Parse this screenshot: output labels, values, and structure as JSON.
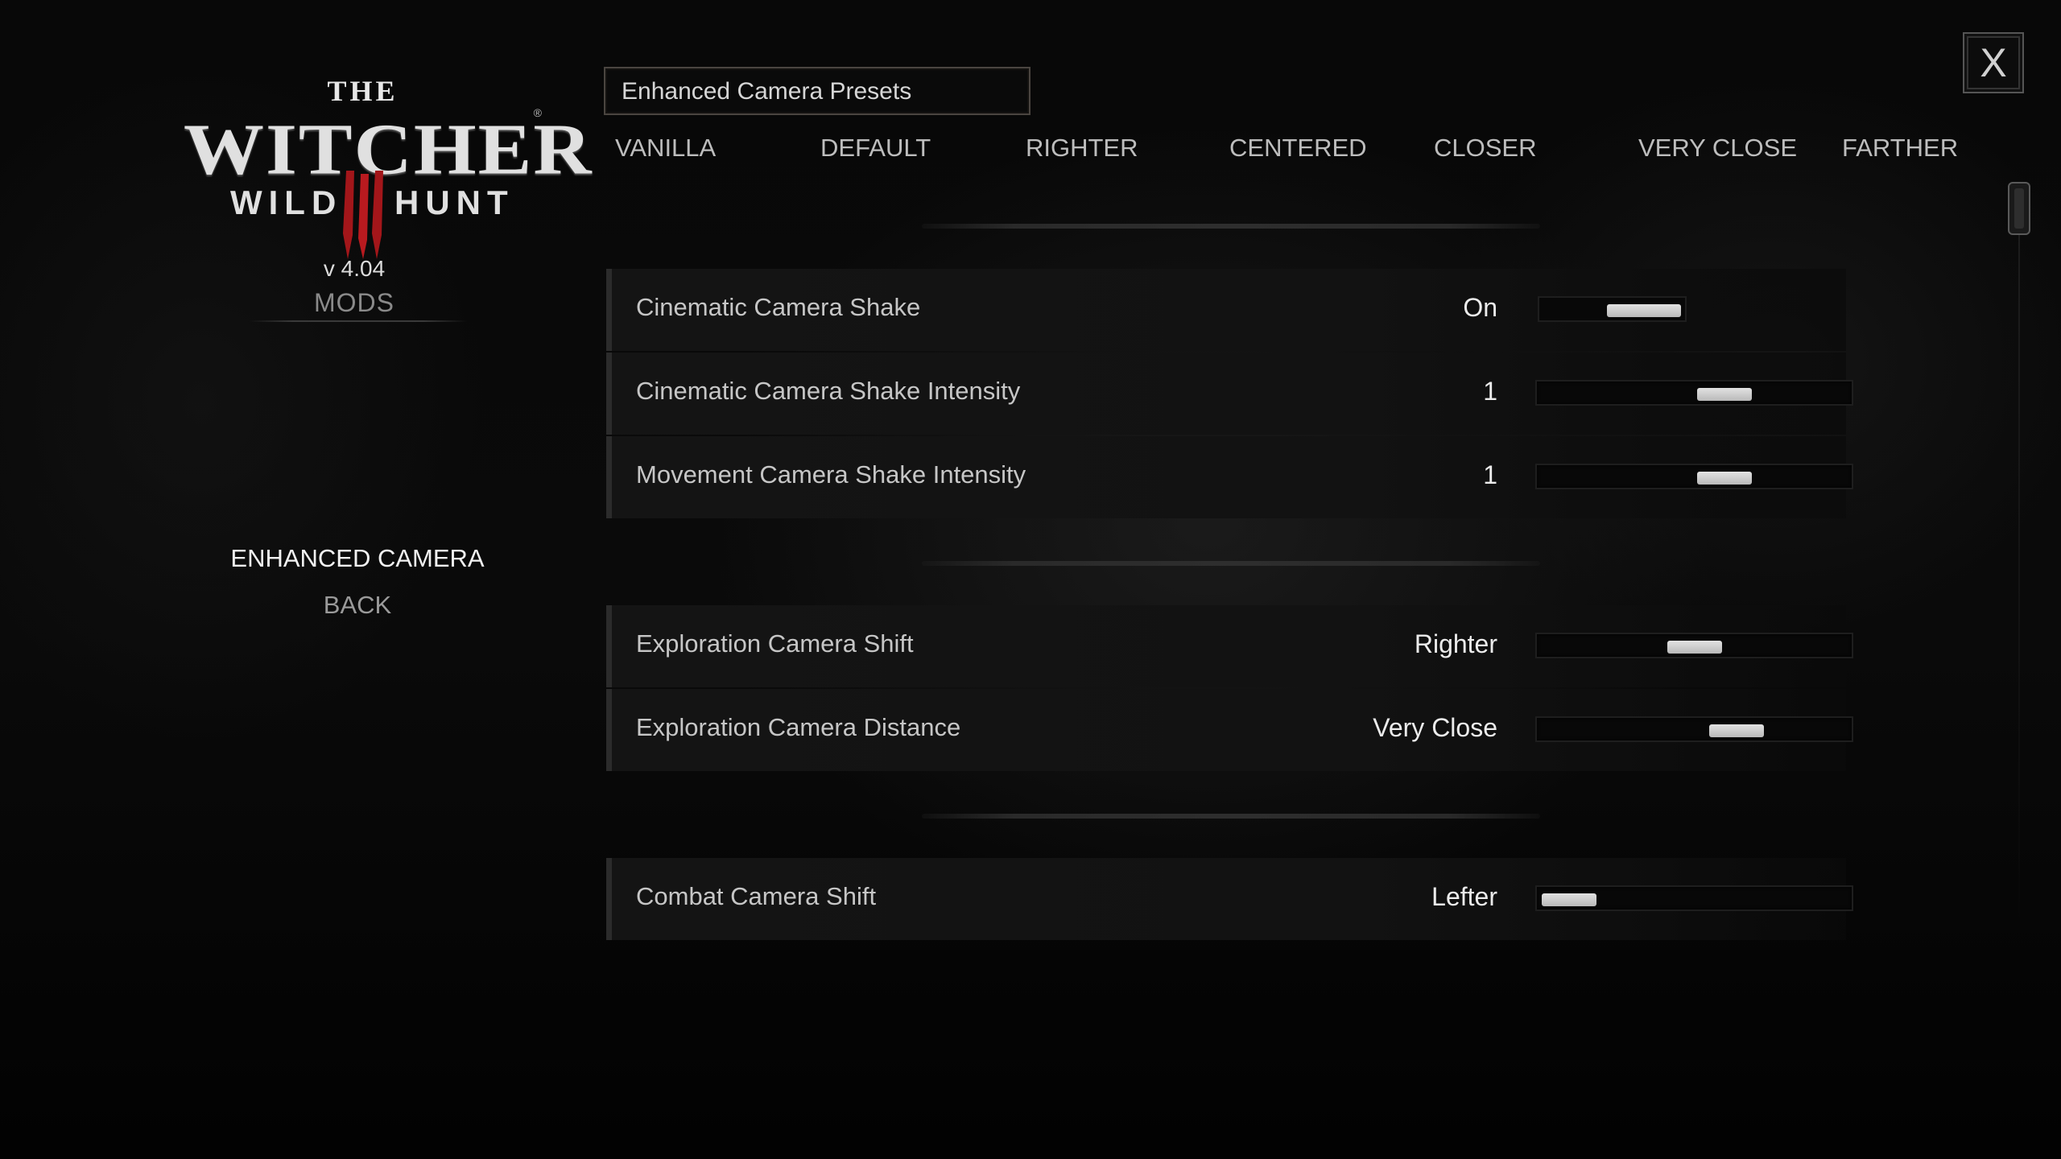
{
  "sidebar": {
    "logo_the": "THE",
    "logo_name": "WITCHER",
    "logo_reg": "®",
    "logo_wild": "WILD",
    "logo_hunt": "HUNT",
    "version": "v 4.04",
    "section_title": "MODS",
    "items": [
      {
        "label": "ENHANCED CAMERA",
        "selected": true
      },
      {
        "label": "BACK",
        "selected": false
      }
    ]
  },
  "presets": {
    "title": "Enhanced Camera Presets",
    "tabs": [
      "VANILLA",
      "DEFAULT",
      "RIGHTER",
      "CENTERED",
      "CLOSER",
      "VERY CLOSE",
      "FARTHER"
    ]
  },
  "settings": {
    "rows": [
      {
        "label": "Cinematic Camera Shake",
        "value": "On",
        "control": "toggle",
        "level": 1.0
      },
      {
        "label": "Cinematic Camera Shake Intensity",
        "value": "1",
        "control": "slider",
        "level": 0.62
      },
      {
        "label": "Movement Camera Shake Intensity",
        "value": "1",
        "control": "slider",
        "level": 0.62
      },
      {
        "label": "Exploration Camera Shift",
        "value": "Righter",
        "control": "slider",
        "level": 0.5
      },
      {
        "label": "Exploration Camera Distance",
        "value": "Very Close",
        "control": "slider",
        "level": 0.67
      },
      {
        "label": "Combat Camera Shift",
        "value": "Lefter",
        "control": "slider",
        "level": 0.0
      }
    ]
  },
  "close_button": {
    "label": "X"
  },
  "icons": {
    "close": "close-icon",
    "logo": "witcher-logo"
  }
}
